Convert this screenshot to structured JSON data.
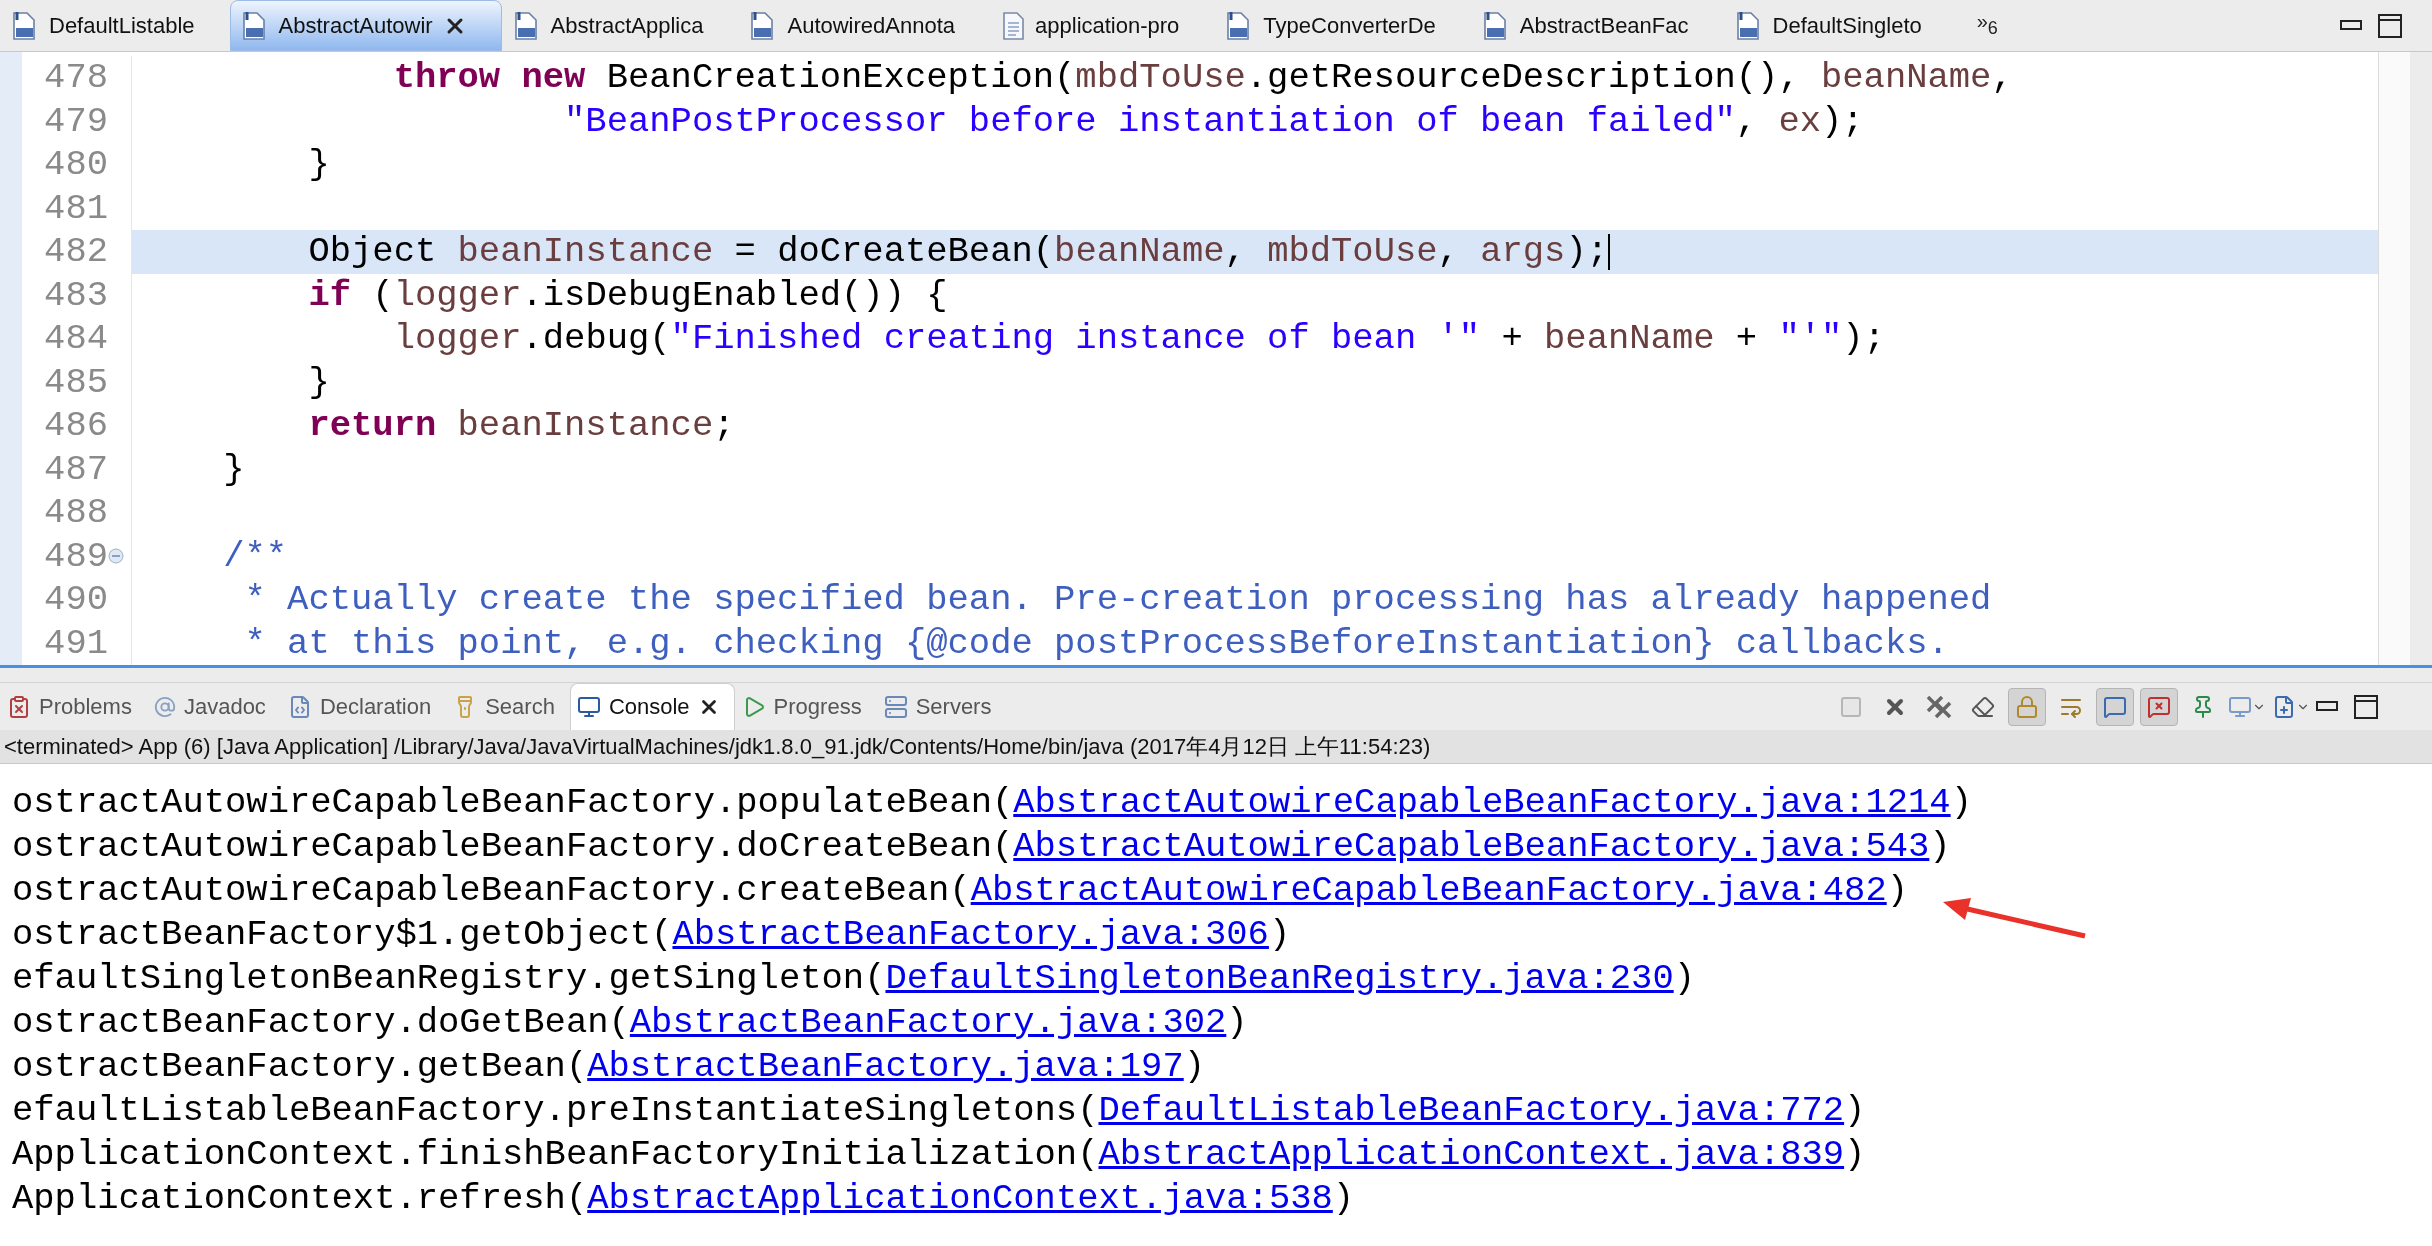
{
  "editor_tabs": [
    {
      "label": "DefaultListable",
      "kind": "class",
      "selected": false
    },
    {
      "label": "AbstractAutowir",
      "kind": "class",
      "selected": true
    },
    {
      "label": "AbstractApplica",
      "kind": "class",
      "selected": false
    },
    {
      "label": "AutowiredAnnota",
      "kind": "class",
      "selected": false
    },
    {
      "label": "application-pro",
      "kind": "file",
      "selected": false
    },
    {
      "label": "TypeConverterDe",
      "kind": "class",
      "selected": false
    },
    {
      "label": "AbstractBeanFac",
      "kind": "class",
      "selected": false
    },
    {
      "label": "DefaultSingleto",
      "kind": "class",
      "selected": false
    }
  ],
  "editor_overflow": {
    "chevron": "»",
    "count": "6"
  },
  "editor": {
    "lines": [
      {
        "number": "478",
        "tokens": [
          {
            "kind": "keyword",
            "text": "            throw new"
          },
          {
            "kind": "plain",
            "text": " BeanCreationException("
          },
          {
            "kind": "variable",
            "text": "mbdToUse"
          },
          {
            "kind": "plain",
            "text": ".getResourceDescription(), "
          },
          {
            "kind": "variable",
            "text": "beanName"
          },
          {
            "kind": "plain",
            "text": ","
          }
        ]
      },
      {
        "number": "479",
        "tokens": [
          {
            "kind": "string",
            "text": "                    \"BeanPostProcessor before instantiation of bean failed\""
          },
          {
            "kind": "plain",
            "text": ", "
          },
          {
            "kind": "variable",
            "text": "ex"
          },
          {
            "kind": "plain",
            "text": ");"
          }
        ]
      },
      {
        "number": "480",
        "tokens": [
          {
            "kind": "plain",
            "text": "        }"
          }
        ]
      },
      {
        "number": "481"
      },
      {
        "number": "482",
        "current": true,
        "tokens": [
          {
            "kind": "plain",
            "text": "        Object "
          },
          {
            "kind": "variable",
            "text": "beanInstance"
          },
          {
            "kind": "plain",
            "text": " = doCreateBean("
          },
          {
            "kind": "variable",
            "text": "beanName"
          },
          {
            "kind": "plain",
            "text": ", "
          },
          {
            "kind": "variable",
            "text": "mbdToUse"
          },
          {
            "kind": "plain",
            "text": ", "
          },
          {
            "kind": "variable",
            "text": "args"
          },
          {
            "kind": "plain",
            "text": ");"
          }
        ]
      },
      {
        "number": "483",
        "tokens": [
          {
            "kind": "keyword",
            "text": "        if"
          },
          {
            "kind": "plain",
            "text": " ("
          },
          {
            "kind": "variable",
            "text": "logger"
          },
          {
            "kind": "plain",
            "text": ".isDebugEnabled()) {"
          }
        ]
      },
      {
        "number": "484",
        "tokens": [
          {
            "kind": "variable",
            "text": "            logger"
          },
          {
            "kind": "plain",
            "text": ".debug("
          },
          {
            "kind": "string",
            "text": "\"Finished creating instance of bean '\""
          },
          {
            "kind": "plain",
            "text": " + "
          },
          {
            "kind": "variable",
            "text": "beanName"
          },
          {
            "kind": "plain",
            "text": " + "
          },
          {
            "kind": "string",
            "text": "\"'\""
          },
          {
            "kind": "plain",
            "text": ");"
          }
        ]
      },
      {
        "number": "485",
        "tokens": [
          {
            "kind": "plain",
            "text": "        }"
          }
        ]
      },
      {
        "number": "486",
        "tokens": [
          {
            "kind": "keyword",
            "text": "        return"
          },
          {
            "kind": "variable",
            "text": " beanInstance"
          },
          {
            "kind": "plain",
            "text": ";"
          }
        ]
      },
      {
        "number": "487",
        "tokens": [
          {
            "kind": "plain",
            "text": "    }"
          }
        ]
      },
      {
        "number": "488"
      },
      {
        "number": "489",
        "foldable": true,
        "tokens": [
          {
            "kind": "javadoc",
            "text": "    /**"
          }
        ]
      },
      {
        "number": "490",
        "tokens": [
          {
            "kind": "javadoc",
            "text": "     * Actually create the specified bean. Pre-creation processing has already happened"
          }
        ]
      },
      {
        "number": "491",
        "tokens": [
          {
            "kind": "javadoc",
            "text": "     * at this point, e.g. checking {@code postProcessBeforeInstantiation} callbacks."
          }
        ]
      }
    ]
  },
  "view_tabs": [
    {
      "label": "Problems",
      "kind": "problems",
      "selected": false
    },
    {
      "label": "Javadoc",
      "kind": "javadoc",
      "selected": false
    },
    {
      "label": "Declaration",
      "kind": "declaration",
      "selected": false
    },
    {
      "label": "Search",
      "kind": "search",
      "selected": false
    },
    {
      "label": "Console",
      "kind": "console",
      "selected": true
    },
    {
      "label": "Progress",
      "kind": "progress",
      "selected": false
    },
    {
      "label": "Servers",
      "kind": "servers",
      "selected": false
    }
  ],
  "console_toolbar": [
    {
      "kind": "terminate",
      "disabled": true,
      "pressed": false
    },
    {
      "kind": "remove",
      "disabled": false,
      "pressed": false
    },
    {
      "kind": "remove-all",
      "disabled": false,
      "pressed": false
    },
    {
      "kind": "clear",
      "disabled": false,
      "pressed": false
    },
    {
      "kind": "scroll-lock",
      "disabled": false,
      "pressed": true
    },
    {
      "kind": "word-wrap",
      "disabled": false,
      "pressed": false
    },
    {
      "kind": "show-on-output",
      "disabled": false,
      "pressed": true
    },
    {
      "kind": "show-on-error",
      "disabled": false,
      "pressed": true
    },
    {
      "kind": "pin",
      "disabled": false,
      "pressed": false
    },
    {
      "kind": "display",
      "disabled": false,
      "pressed": false
    },
    {
      "kind": "open",
      "disabled": false,
      "pressed": false
    }
  ],
  "console": {
    "header": "<terminated> App (6) [Java Application] /Library/Java/JavaVirtualMachines/jdk1.8.0_91.jdk/Contents/Home/bin/java (2017年4月12日 上午11:54:23)",
    "lines": [
      {
        "text": "ostractAutowireCapableBeanFactory.populateBean(",
        "link": "AbstractAutowireCapableBeanFactory.java:1214",
        "tail": ")"
      },
      {
        "text": "ostractAutowireCapableBeanFactory.doCreateBean(",
        "link": "AbstractAutowireCapableBeanFactory.java:543",
        "tail": ")"
      },
      {
        "text": "ostractAutowireCapableBeanFactory.createBean(",
        "link": "AbstractAutowireCapableBeanFactory.java:482",
        "tail": ")"
      },
      {
        "text": "ostractBeanFactory$1.getObject(",
        "link": "AbstractBeanFactory.java:306",
        "tail": ")"
      },
      {
        "text": "efaultSingletonBeanRegistry.getSingleton(",
        "link": "DefaultSingletonBeanRegistry.java:230",
        "tail": ")"
      },
      {
        "text": "ostractBeanFactory.doGetBean(",
        "link": "AbstractBeanFactory.java:302",
        "tail": ")"
      },
      {
        "text": "ostractBeanFactory.getBean(",
        "link": "AbstractBeanFactory.java:197",
        "tail": ")"
      },
      {
        "text": "efaultListableBeanFactory.preInstantiateSingletons(",
        "link": "DefaultListableBeanFactory.java:772",
        "tail": ")"
      },
      {
        "text": "ApplicationContext.finishBeanFactoryInitialization(",
        "link": "AbstractApplicationContext.java:839",
        "tail": ")"
      },
      {
        "text": "ApplicationContext.refresh(",
        "link": "AbstractApplicationContext.java:538",
        "tail": ")"
      }
    ]
  }
}
